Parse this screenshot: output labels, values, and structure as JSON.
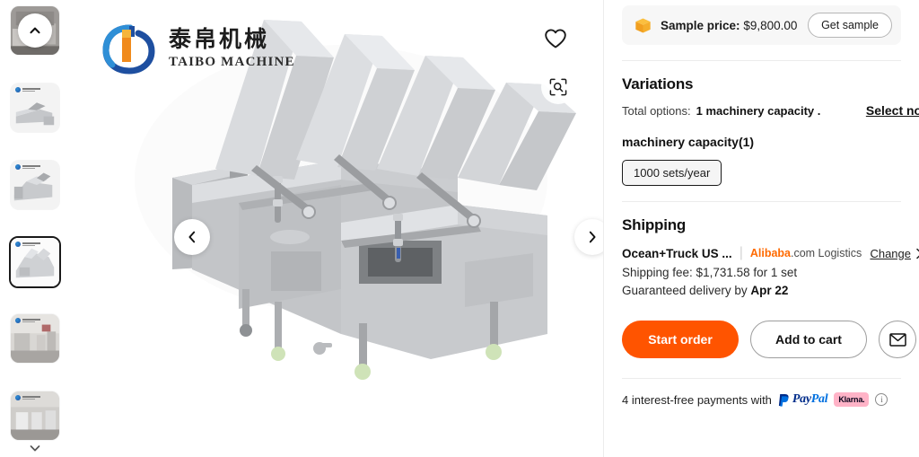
{
  "gallery": {
    "brand": {
      "chinese_name": "泰帛机械",
      "english_name": "TAIBO MACHINE"
    },
    "wishlist_icon": "heart-icon",
    "zoom_icon": "image-zoom-icon",
    "prev_label": "‹",
    "next_label": "›",
    "thumb_up_label": "⌃",
    "thumb_down_label": "⌄",
    "selected_thumb_index": 3,
    "thumbnails": [
      {
        "alt": "machine front view"
      },
      {
        "alt": "machine side view"
      },
      {
        "alt": "machine line view"
      },
      {
        "alt": "machine open lids view"
      },
      {
        "alt": "factory installation photo"
      },
      {
        "alt": "factory workshop photo"
      }
    ]
  },
  "detail": {
    "sample": {
      "icon": "package-box-icon",
      "label": "Sample price:",
      "price": "$9,800.00",
      "button": "Get sample"
    },
    "variations": {
      "title": "Variations",
      "total_options_label": "Total options:",
      "total_options_value": "1 machinery capacity .",
      "select_now": "Select now",
      "group_name": "machinery capacity(1)",
      "options": [
        "1000 sets/year"
      ]
    },
    "shipping": {
      "title": "Shipping",
      "method": "Ocean+Truck US ...",
      "logistics_brand": "Alibaba",
      "logistics_suffix": ".com Logistics",
      "change_label": "Change",
      "change_icon": "chevron-right-icon",
      "fee": "Shipping fee: $1,731.58 for 1 set",
      "delivery_prefix": "Guaranteed delivery by",
      "delivery_date": "Apr 22"
    },
    "actions": {
      "start_order": "Start order",
      "add_to_cart": "Add to cart",
      "message_icon": "envelope-icon"
    },
    "payment": {
      "text": "4 interest-free payments with",
      "paypal_pay": "Pay",
      "paypal_pal": "Pal",
      "klarna": "Klarna.",
      "info_icon": "info-icon",
      "info_glyph": "i"
    }
  },
  "colors": {
    "accent_orange": "#FF5400",
    "alibaba_orange": "#FF6A00",
    "klarna_pink": "#FFB3C7",
    "paypal_blue": "#002C8A"
  }
}
